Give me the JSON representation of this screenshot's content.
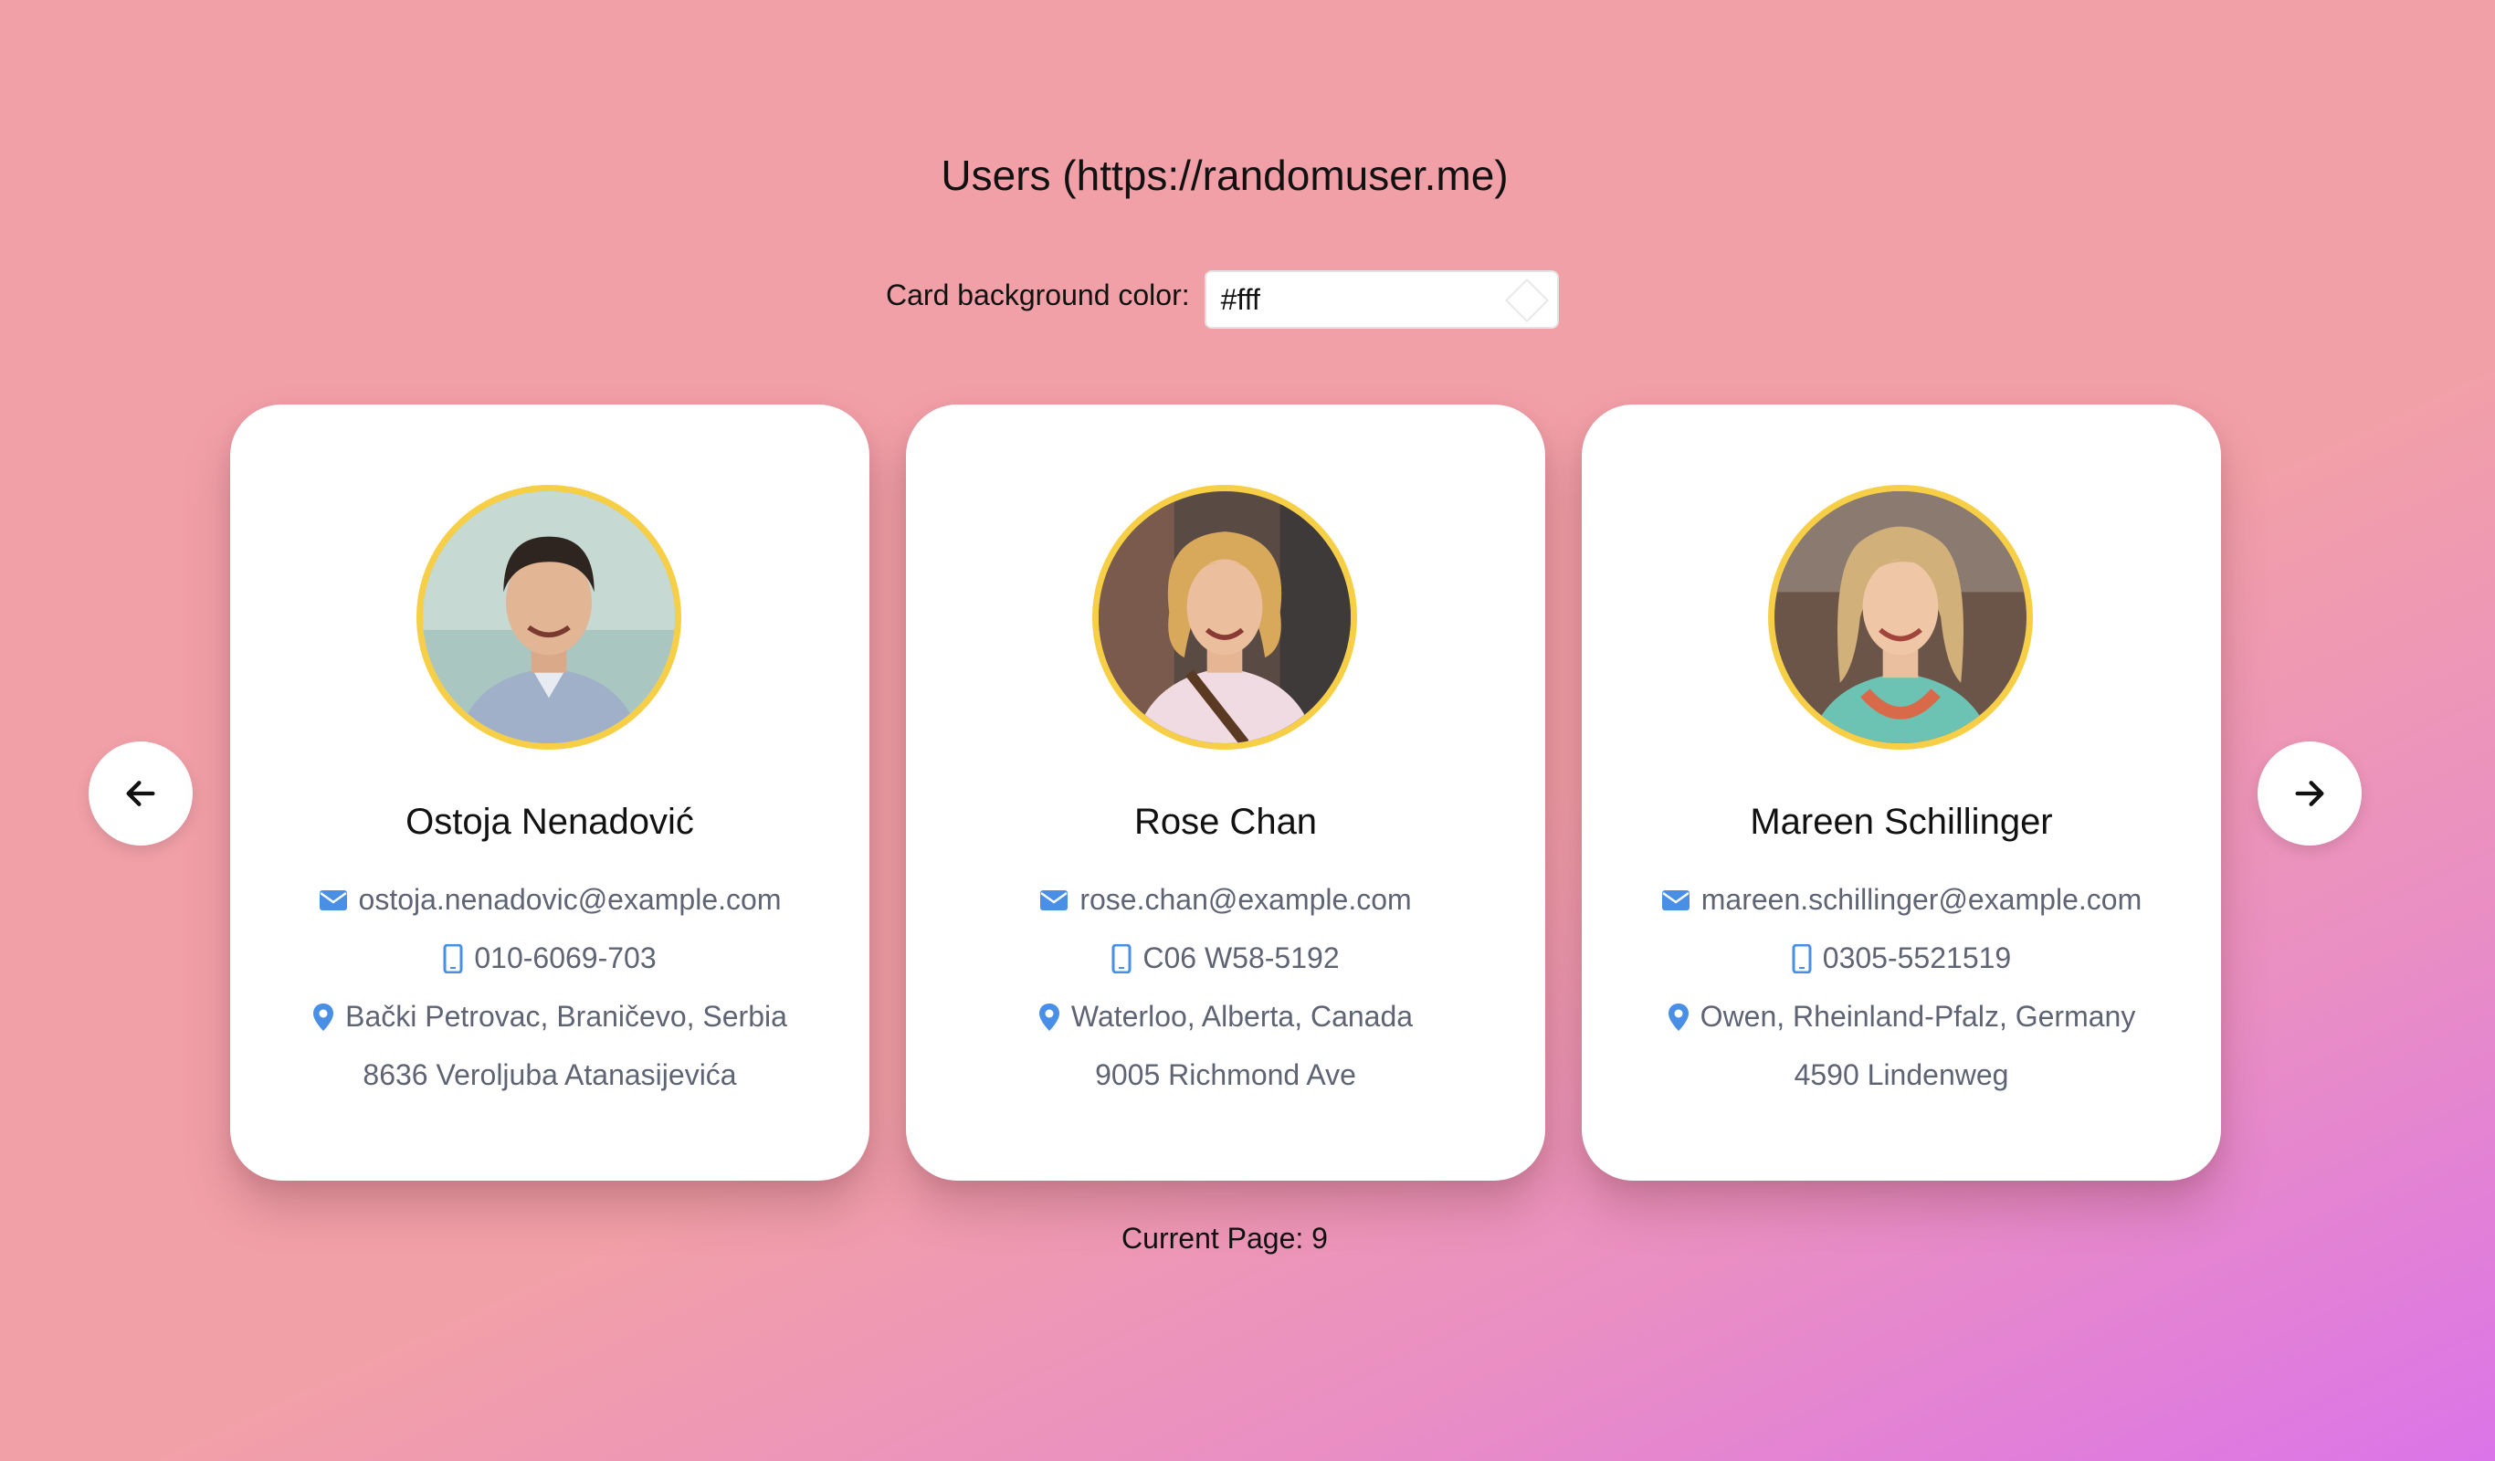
{
  "header": {
    "title": "Users (https://randomuser.me)"
  },
  "color_picker": {
    "label": "Card background color:",
    "value": "#fff"
  },
  "colors": {
    "card_background": "#ffffff",
    "avatar_border": "#f7cf46",
    "icon_blue": "#4a8fe6",
    "info_text": "#5f6475"
  },
  "users": [
    {
      "name": "Ostoja Nenadović",
      "email": "ostoja.nenadovic@example.com",
      "phone": "010-6069-703",
      "location": "Bački Petrovac, Braničevo, Serbia",
      "street": "8636 Veroljuba Atanasijevića"
    },
    {
      "name": "Rose Chan",
      "email": "rose.chan@example.com",
      "phone": "C06 W58-5192",
      "location": "Waterloo, Alberta, Canada",
      "street": "9005 Richmond Ave"
    },
    {
      "name": "Mareen Schillinger",
      "email": "mareen.schillinger@example.com",
      "phone": "0305-5521519",
      "location": "Owen, Rheinland-Pfalz, Germany",
      "street": "4590 Lindenweg"
    }
  ],
  "pagination": {
    "label": "Current Page: 9",
    "prev_icon": "arrow-left-icon",
    "next_icon": "arrow-right-icon"
  }
}
